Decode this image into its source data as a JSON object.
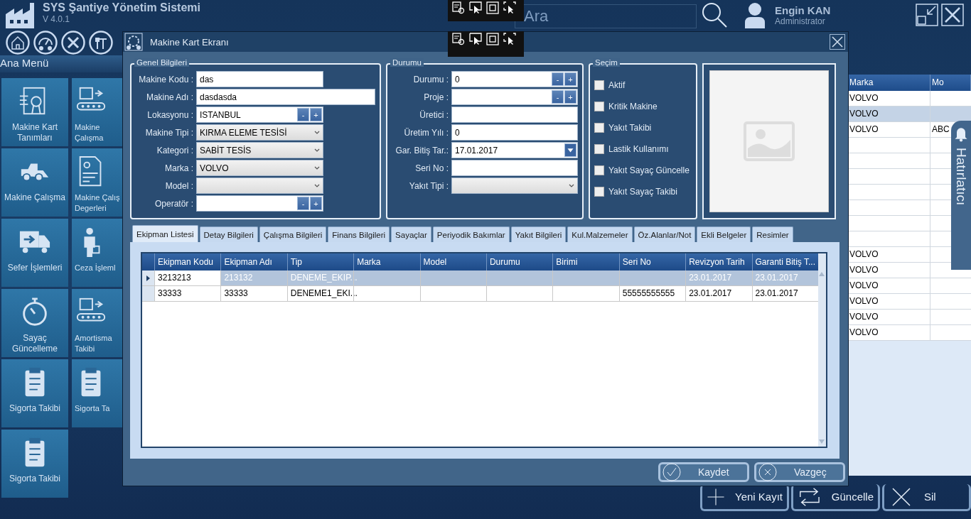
{
  "app": {
    "title": "SYS Şantiye Yönetim Sistemi",
    "version": "V 4.0.1",
    "search": {
      "placeholder": "Ara"
    },
    "user": {
      "name": "Engin KAN",
      "role": "Administrator"
    }
  },
  "sidebar": {
    "title": "Ana Menü",
    "tiles": [
      {
        "label": "Makine Kart Tanımları"
      },
      {
        "label": "Makine Çalışma"
      },
      {
        "label": "Makine Çalışma"
      },
      {
        "label": "Makine Çalış Degerleri"
      },
      {
        "label": "Sefer İşlemleri"
      },
      {
        "label": "Ceza İşleml"
      },
      {
        "label": "Sayaç Güncelleme"
      },
      {
        "label": "Amortisma Takibi"
      },
      {
        "label": "Sigorta Takibi"
      },
      {
        "label": "Sigorta Ta"
      },
      {
        "label": "Sigorta Takibi"
      }
    ]
  },
  "background_table": {
    "columns": [
      "Marka",
      "Mo"
    ],
    "rows": [
      {
        "marka": "VOLVO",
        "selected": false
      },
      {
        "marka": "VOLVO",
        "selected": true
      },
      {
        "marka": "VOLVO",
        "column_2": "ABC",
        "selected": false
      },
      {
        "selected": false
      },
      {
        "selected": false
      },
      {
        "selected": false
      },
      {
        "selected": false
      },
      {
        "selected": false
      },
      {
        "selected": false
      },
      {
        "selected": false
      },
      {
        "marka": "VOLVO",
        "selected": false
      },
      {
        "marka": "VOLVO",
        "selected": false
      },
      {
        "marka": "VOLVO",
        "selected": false
      },
      {
        "marka": "VOLVO",
        "selected": false
      },
      {
        "marka": "VOLVO",
        "selected": false
      },
      {
        "marka": "VOLVO",
        "selected": false
      }
    ]
  },
  "reminder_tab": {
    "label": "Hatırlatıcı"
  },
  "actions": [
    "Yeni Kayıt",
    "Güncelle",
    "Sil"
  ],
  "dialog": {
    "title": "Makine Kart Ekranı",
    "general": {
      "legend": "Genel Bilgileri",
      "fields": [
        {
          "label": "Makine Kodu :",
          "kind": "text",
          "value": "das"
        },
        {
          "label": "Makine Adı :",
          "kind": "wide",
          "value": "dasdasda"
        },
        {
          "label": "Lokasyonu :",
          "kind": "stepper",
          "value": "ISTANBUL",
          "buttons": [
            "-",
            "+"
          ]
        },
        {
          "label": "Makine Tipi :",
          "kind": "select",
          "value": "KIRMA ELEME TESİSİ"
        },
        {
          "label": "Kategori :",
          "kind": "select",
          "value": "SABİT TESİS"
        },
        {
          "label": "Marka :",
          "kind": "select",
          "value": "VOLVO"
        },
        {
          "label": "Model :",
          "kind": "select"
        },
        {
          "label": "Operatör :",
          "kind": "stepper",
          "buttons": [
            "-",
            "+"
          ]
        }
      ]
    },
    "status": {
      "legend": "Durumu",
      "fields": [
        {
          "label": "Durumu :",
          "kind": "stepper",
          "value": "0",
          "buttons": [
            "-",
            "+"
          ]
        },
        {
          "label": "Proje :",
          "kind": "stepper",
          "buttons": [
            "-",
            "+"
          ]
        },
        {
          "label": "Üretici :",
          "kind": "text"
        },
        {
          "label": "Üretim Yılı :",
          "kind": "text",
          "value": "0"
        },
        {
          "label": "Gar. Bitiş Tar.:",
          "kind": "date",
          "value": "17.01.2017"
        },
        {
          "label": "Seri No :",
          "kind": "text"
        },
        {
          "label": "Yakıt Tipi :",
          "kind": "select"
        }
      ]
    },
    "options": {
      "legend": "Seçim",
      "checkboxes": [
        {
          "label": "Aktif",
          "checked": false
        },
        {
          "label": "Kritik Makine",
          "checked": false
        },
        {
          "label": "Yakıt Takibi",
          "checked": false
        },
        {
          "label": "Lastik Kullanımı",
          "checked": false
        },
        {
          "label": "Yakıt Sayaç Güncelle",
          "checked": false
        },
        {
          "label": "Yakıt Sayaç Takibi",
          "checked": false
        }
      ]
    },
    "tabs": [
      {
        "label": "Ekipman Listesi",
        "selected": true
      },
      {
        "label": "Detay Bilgileri",
        "selected": false
      },
      {
        "label": "Çalışma Bilgileri",
        "selected": false
      },
      {
        "label": "Finans Bilgileri",
        "selected": false
      },
      {
        "label": "Sayaçlar",
        "selected": false
      },
      {
        "label": "Periyodik Bakımlar",
        "selected": false
      },
      {
        "label": "Yakıt Bilgileri",
        "selected": false
      },
      {
        "label": "Kul.Malzemeler",
        "selected": false
      },
      {
        "label": "Öz.Alanlar/Not",
        "selected": false
      },
      {
        "label": "Ekli Belgeler",
        "selected": false
      },
      {
        "label": "Resimler",
        "selected": false
      }
    ],
    "table": {
      "columns": [
        "Ekipman Kodu",
        "Ekipman Adı",
        "Tip",
        "Marka",
        "Model",
        "Durumu",
        "Birimi",
        "Seri No",
        "Revizyon Tarih",
        "Garanti Bitiş T..."
      ],
      "rows": [
        {
          "selected": true,
          "cells": {
            "ekipman_kodu": "3213213",
            "ekipman_adi": "213132",
            "tip": "DENEME_EKIP...",
            "revizyon_tarih": "23.01.2017",
            "garanti_bitis": "23.01.2017"
          }
        },
        {
          "selected": false,
          "cells": {
            "ekipman_kodu": "33333",
            "ekipman_adi": "33333",
            "tip": "DENEME1_EKI...",
            "seri_no": "55555555555",
            "revizyon_tarih": "23.01.2017",
            "garanti_bitis": "23.01.2017"
          }
        }
      ]
    },
    "buttons": [
      "Kaydet",
      "Vazgeç"
    ]
  }
}
